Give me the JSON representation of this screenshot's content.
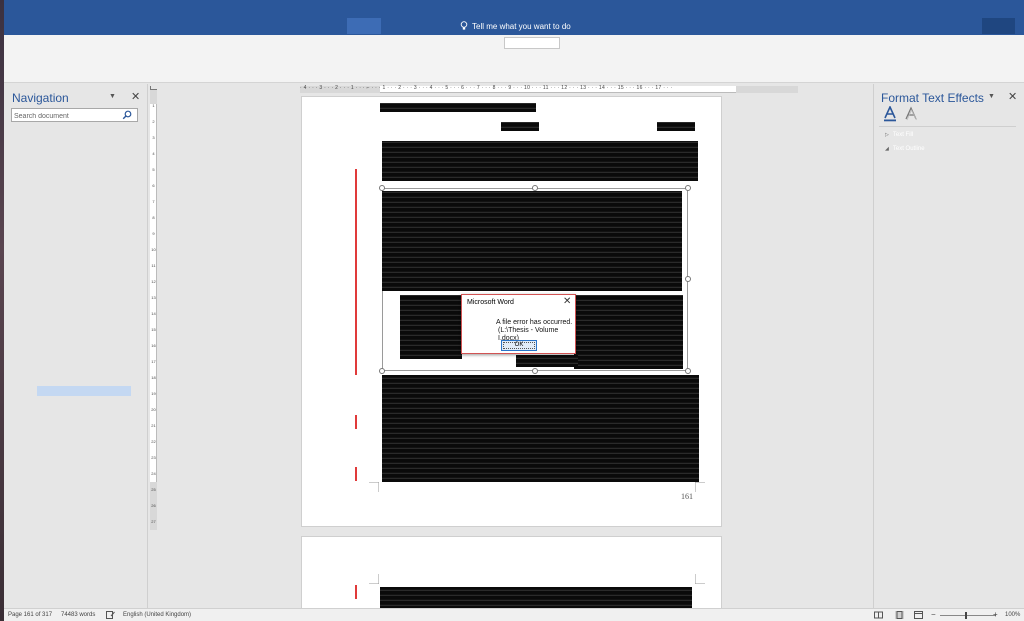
{
  "titlebar": {
    "tell_me": "Tell me what you want to do"
  },
  "navigation": {
    "title": "Navigation",
    "search_placeholder": "Search document"
  },
  "ruler": {
    "horizontal_labels": "· 4 · · · 3 · · · 2 · · · 1 · · · ⌐ · · · 1 · · · 2 · · · 3 · · · 4 · · · 5 · · · 6 · · · 7 · · · 8 · · · 9 · · · 10 · · · 11 · · · 12 · · · 13 · · · 14 · · · 15 · · · 16 · · · 17 · · ·",
    "vertical_labels": [
      "1",
      "2",
      "3",
      "4",
      "5",
      "6",
      "7",
      "8",
      "9",
      "10",
      "11",
      "12",
      "13",
      "14",
      "15",
      "16",
      "17",
      "18",
      "19",
      "20",
      "21",
      "22",
      "23",
      "24",
      "25",
      "26",
      "27"
    ]
  },
  "document": {
    "page_number": "161"
  },
  "dialog": {
    "title": "Microsoft Word",
    "message_line1": "A file error has occurred.",
    "message_line2": "(L:\\Thesis - Volume I.docx)",
    "ok_label": "OK"
  },
  "format_pane": {
    "title": "Format Text Effects",
    "sections": [
      {
        "label": "Text Fill"
      },
      {
        "label": "Text Outline"
      }
    ]
  },
  "statusbar": {
    "page": "Page 161 of 317",
    "words": "74483 words",
    "language": "English (United Kingdom)",
    "zoom": "100%"
  },
  "colors": {
    "title_blue": "#2b579a",
    "error_border": "#d15353",
    "track_change_red": "#e03a3a"
  }
}
